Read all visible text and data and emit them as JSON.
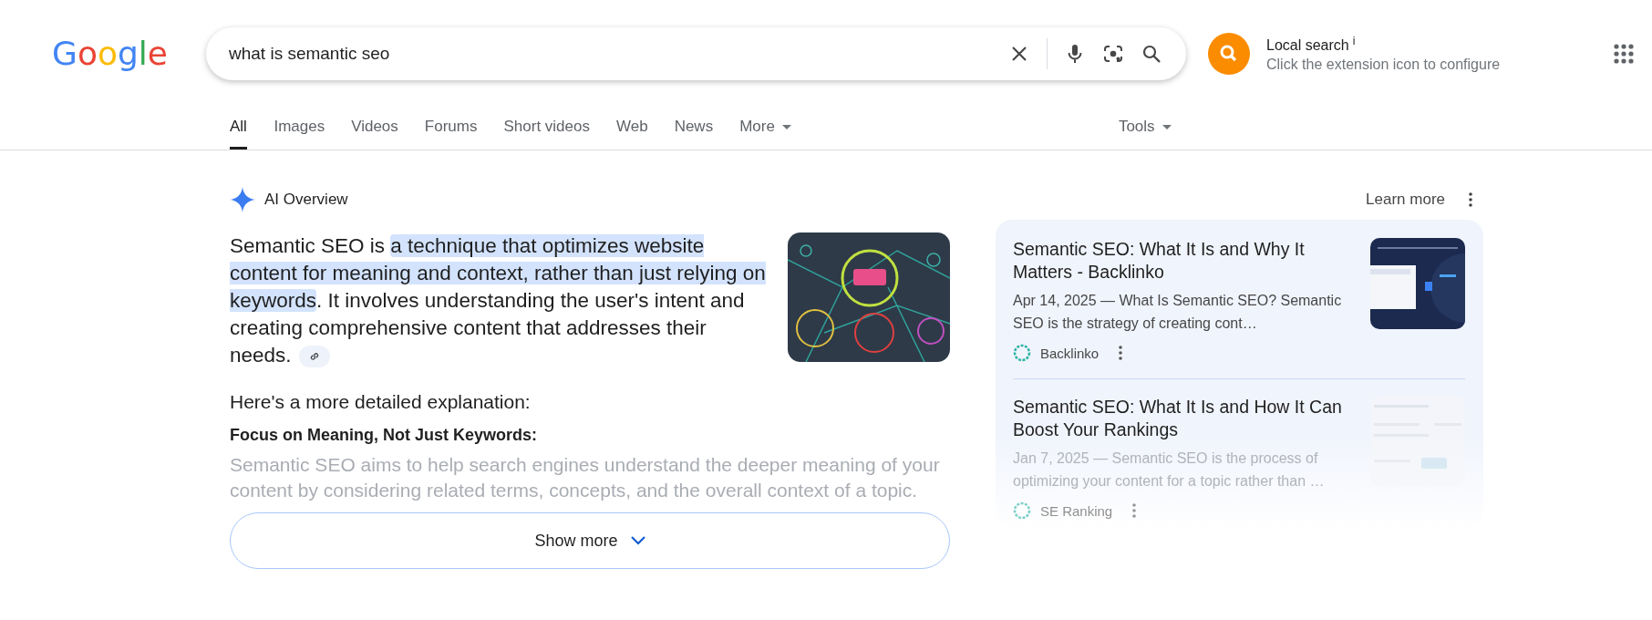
{
  "logo": [
    {
      "text": "G",
      "color": "#4285f4"
    },
    {
      "text": "o",
      "color": "#ea4335"
    },
    {
      "text": "o",
      "color": "#fbbc05"
    },
    {
      "text": "g",
      "color": "#4285f4"
    },
    {
      "text": "l",
      "color": "#34a853"
    },
    {
      "text": "e",
      "color": "#ea4335"
    }
  ],
  "search": {
    "value": "what is semantic seo"
  },
  "extension": {
    "title": "Local search",
    "info": "i",
    "subtitle": "Click the extension icon to configure"
  },
  "tabs": [
    {
      "label": "All",
      "selected": true,
      "kind": "link"
    },
    {
      "label": "Images",
      "selected": false,
      "kind": "link"
    },
    {
      "label": "Videos",
      "selected": false,
      "kind": "link"
    },
    {
      "label": "Forums",
      "selected": false,
      "kind": "link"
    },
    {
      "label": "Short videos",
      "selected": false,
      "kind": "link"
    },
    {
      "label": "Web",
      "selected": false,
      "kind": "link"
    },
    {
      "label": "News",
      "selected": false,
      "kind": "link"
    },
    {
      "label": "More",
      "selected": false,
      "kind": "menu"
    }
  ],
  "tools": {
    "label": "Tools"
  },
  "ai_overview": {
    "title": "AI Overview",
    "learn_more": "Learn more",
    "summary": [
      {
        "text": "Semantic SEO is ",
        "highlighted": false
      },
      {
        "text": "a technique that optimizes website content for meaning and context, rather than just relying on keywords",
        "highlighted": true
      },
      {
        "text": ". It involves understanding the user's intent and creating comprehensive content that addresses their needs.",
        "highlighted": false
      }
    ],
    "heading": "Here's a more detailed explanation:",
    "subheading": "Focus on Meaning, Not Just Keywords:",
    "detail": {
      "text": "Semantic SEO aims to help search engines understand the deeper meaning of your content by considering related terms, concepts, and the overall context of a topic.",
      "faded": true
    },
    "show_more": "Show more"
  },
  "sources": [
    {
      "title": "Semantic SEO: What It Is and Why It Matters - Backlinko",
      "snippet": "Apr 14, 2025 — What Is Semantic SEO? Semantic SEO is the strategy of creating cont…",
      "site": "Backlinko",
      "faded": false
    },
    {
      "title": "Semantic SEO: What It Is and How It Can Boost Your Rankings",
      "snippet": "Jan 7, 2025 — Semantic SEO is the process of optimizing your content for a topic rather than …",
      "site": "SE Ranking",
      "faded": true
    }
  ]
}
